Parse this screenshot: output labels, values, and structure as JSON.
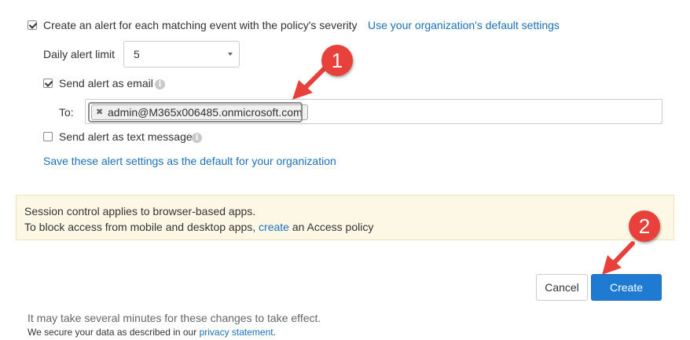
{
  "alert": {
    "create_alert_label": "Create an alert for each matching event with the policy's severity",
    "org_default_link": "Use your organization's default settings",
    "daily_limit_label": "Daily alert limit",
    "daily_limit_value": "5",
    "send_email_label": "Send alert as email",
    "to_label": "To:",
    "recipient": "admin@M365x006485.onmicrosoft.com",
    "send_text_label": "Send alert as text message",
    "save_default_link": "Save these alert settings as the default for your organization"
  },
  "banner": {
    "line1": "Session control applies to browser-based apps.",
    "line2_prefix": "To block access from mobile and desktop apps, ",
    "line2_link": "create",
    "line2_suffix": " an Access policy"
  },
  "actions": {
    "cancel_label": "Cancel",
    "create_label": "Create"
  },
  "footer": {
    "note": "It may take several minutes for these changes to take effect.",
    "privacy_prefix": "We secure your data as described in our ",
    "privacy_link": "privacy statement",
    "privacy_suffix": "."
  },
  "callouts": {
    "step1": "1",
    "step2": "2",
    "badge_color": "#e8403a"
  },
  "colors": {
    "link": "#1e6fb5",
    "primary_button": "#1f7bd2",
    "banner_bg": "#fdf8e6"
  },
  "icons": {
    "info": "info-icon",
    "chip_remove": "close-icon",
    "select_caret": "chevron-down-icon"
  }
}
